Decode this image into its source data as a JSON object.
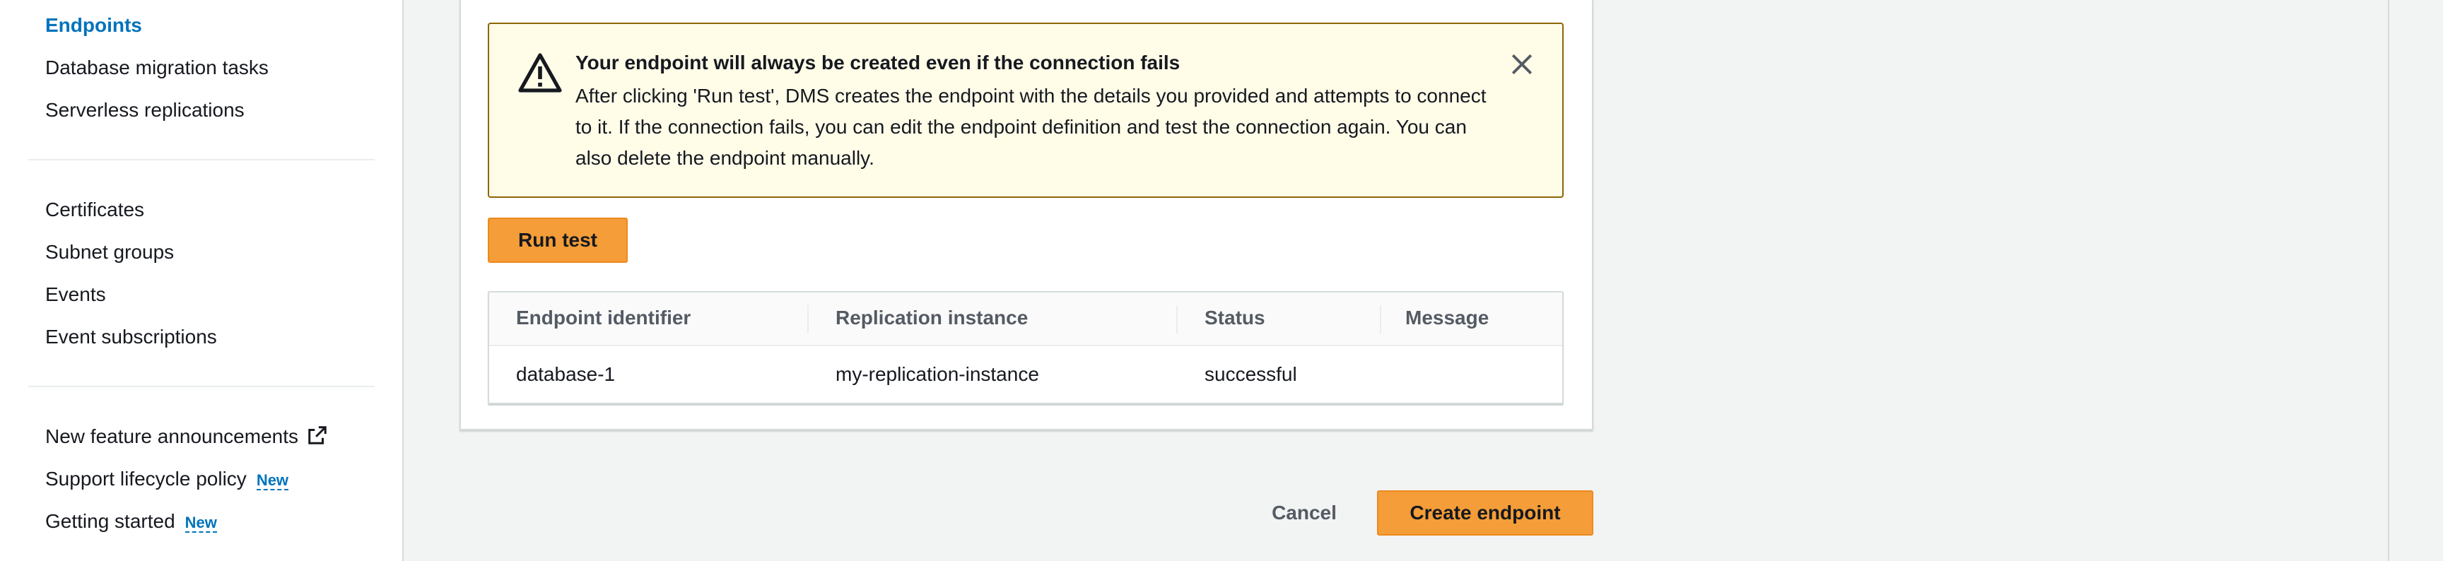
{
  "sidebar": {
    "items_top": [
      {
        "label": "Endpoints",
        "active": true
      },
      {
        "label": "Database migration tasks"
      },
      {
        "label": "Serverless replications"
      }
    ],
    "items_mid": [
      {
        "label": "Certificates"
      },
      {
        "label": "Subnet groups"
      },
      {
        "label": "Events"
      },
      {
        "label": "Event subscriptions"
      }
    ],
    "items_bottom": [
      {
        "label": "New feature announcements",
        "icon": "external-link-icon"
      },
      {
        "label": "Support lifecycle policy",
        "badge": "New"
      },
      {
        "label": "Getting started",
        "badge": "New"
      }
    ]
  },
  "alert": {
    "icon": "warning-icon",
    "title": "Your endpoint will always be created even if the connection fails",
    "body": "After clicking 'Run test', DMS creates the endpoint with the details you provided and attempts to connect to it. If the connection fails, you can edit the endpoint definition and test the connection again. You can also delete the endpoint manually.",
    "close_icon": "close-icon"
  },
  "run_test_label": "Run test",
  "table": {
    "columns": [
      "Endpoint identifier",
      "Replication instance",
      "Status",
      "Message"
    ],
    "rows": [
      {
        "endpoint_identifier": "database-1",
        "replication_instance": "my-replication-instance",
        "status": "successful",
        "message": ""
      }
    ]
  },
  "footer": {
    "cancel_label": "Cancel",
    "create_label": "Create endpoint"
  },
  "colors": {
    "accent": "#0073bb",
    "primary_button": "#f59d38",
    "alert_background": "#fffce8",
    "alert_border": "#8d6605"
  }
}
